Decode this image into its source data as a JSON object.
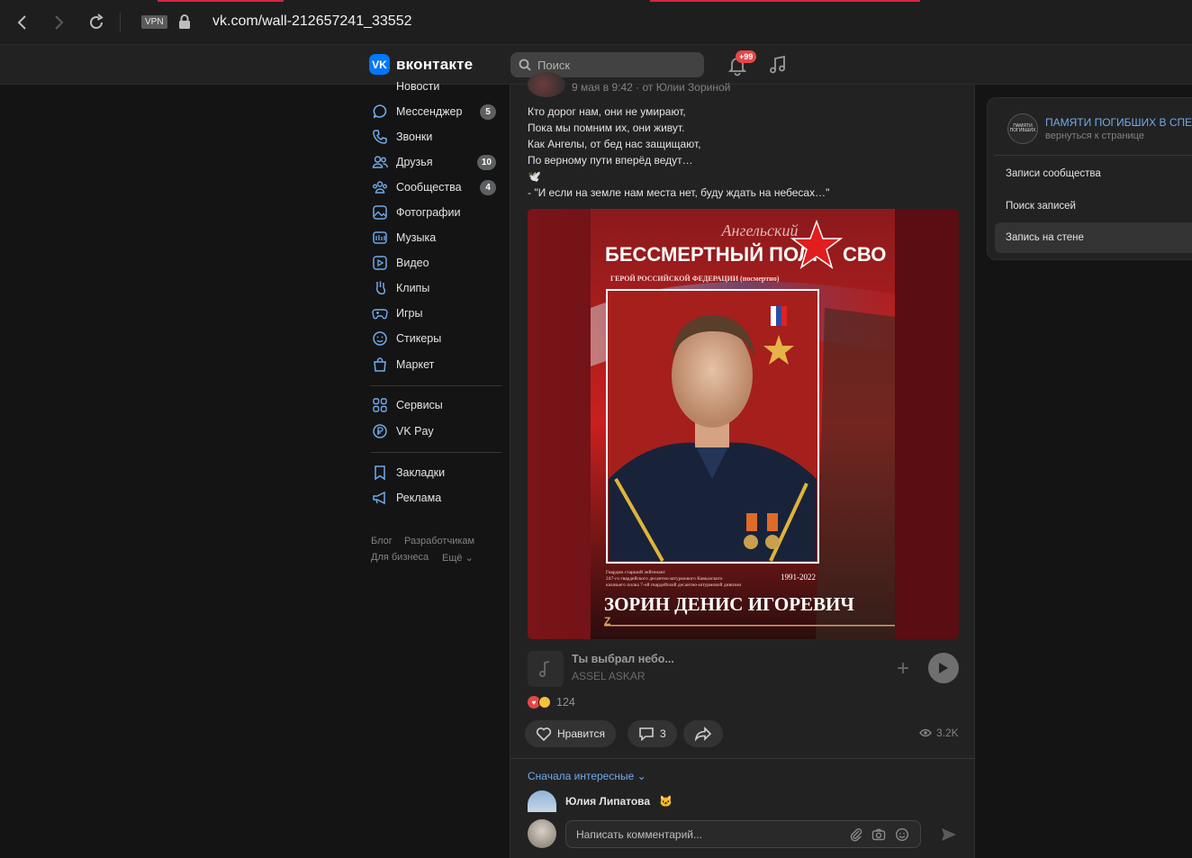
{
  "browser": {
    "url": "vk.com/wall-212657241_33552",
    "vpn_label": "VPN"
  },
  "header": {
    "logo_text": "вконтакте",
    "search_placeholder": "Поиск",
    "notifications_badge": "+99",
    "accent_color": "#0077ff"
  },
  "sidebar": {
    "items": [
      {
        "label": "Новости",
        "icon": "news-icon"
      },
      {
        "label": "Мессенджер",
        "icon": "messenger-icon",
        "count": "5"
      },
      {
        "label": "Звонки",
        "icon": "phone-icon"
      },
      {
        "label": "Друзья",
        "icon": "friends-icon",
        "count": "10"
      },
      {
        "label": "Сообщества",
        "icon": "communities-icon",
        "count": "4"
      },
      {
        "label": "Фотографии",
        "icon": "photos-icon"
      },
      {
        "label": "Музыка",
        "icon": "music-icon"
      },
      {
        "label": "Видео",
        "icon": "video-icon"
      },
      {
        "label": "Клипы",
        "icon": "clips-icon"
      },
      {
        "label": "Игры",
        "icon": "games-icon"
      },
      {
        "label": "Стикеры",
        "icon": "stickers-icon"
      },
      {
        "label": "Маркет",
        "icon": "market-icon"
      },
      {
        "label": "Сервисы",
        "icon": "services-icon"
      },
      {
        "label": "VK Pay",
        "icon": "vkpay-icon"
      },
      {
        "label": "Закладки",
        "icon": "bookmarks-icon"
      },
      {
        "label": "Реклама",
        "icon": "ads-icon"
      }
    ],
    "footer": {
      "blog": "Блог",
      "developers": "Разработчикам",
      "business": "Для бизнеса",
      "more": "Ещё"
    }
  },
  "post": {
    "meta": "9 мая в 9:42  ·  от Юлии Зориной",
    "text_lines": [
      "Кто дорог нам, они не умирают,",
      "Пока мы помним их, они живут.",
      "Как Ангелы, от бед нас защищают,",
      "По верному пути вперёд ведут…",
      "🕊️",
      "- \"И если на земле нам места нет, буду ждать на небесах…\""
    ],
    "image": {
      "script_title": "Ангельский",
      "headline_left": "БЕССМЕРТНЫЙ ПОЛК",
      "headline_right": "СВО",
      "subtitle": "ГЕРОЙ РОССИЙСКОЙ ФЕДЕРАЦИИ (посмертно)",
      "rank_lines": [
        "Гвардии старший лейтенант",
        "247-го гвардейского десантно-штурмового Кавказского",
        "казачьего полка 7-ой гвардейской десантно-штурмовой дивизии"
      ],
      "years": "1991-2022",
      "name": "ЗОРИН ДЕНИС ИГОРЕВИЧ",
      "footer_tag": "Z"
    },
    "audio": {
      "title": "Ты выбрал небо...",
      "artist": "ASSEL ASKAR"
    },
    "reactions_count": "124",
    "like_label": "Нравится",
    "comments_count": "3",
    "views": "3.2K",
    "sort_label": "Сначала интересные",
    "comment_author": "Юлия Липатова",
    "comment_placeholder": "Написать комментарий..."
  },
  "right_panel": {
    "community_name": "ПАМЯТИ ПОГИБШИХ В СПЕЦ",
    "community_avatar_text": "ПАМЯТИ ПОГИБШИХ",
    "back_label": "вернуться к странице",
    "items": [
      {
        "label": "Записи сообщества"
      },
      {
        "label": "Поиск записей"
      },
      {
        "label": "Запись на стене",
        "active": true
      }
    ]
  }
}
